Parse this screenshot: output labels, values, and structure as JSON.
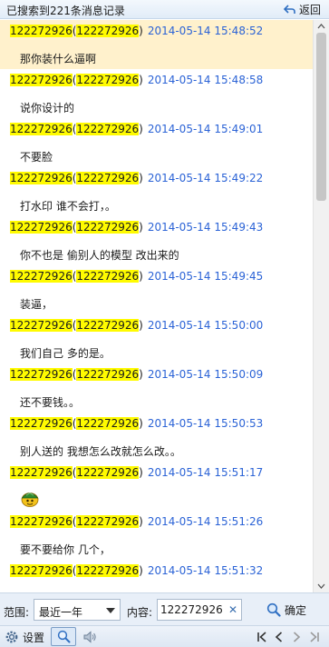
{
  "topbar": {
    "result_text": "已搜索到221条消息记录",
    "back_label": "返回"
  },
  "messages": [
    {
      "sender": "122272926",
      "sender_id": "122272926",
      "timestamp": "2014-05-14 15:48:52",
      "text": "那你装什么逼啊",
      "highlighted": true
    },
    {
      "sender": "122272926",
      "sender_id": "122272926",
      "timestamp": "2014-05-14 15:48:58",
      "text": "说你设计的"
    },
    {
      "sender": "122272926",
      "sender_id": "122272926",
      "timestamp": "2014-05-14 15:49:01",
      "text": "不要脸"
    },
    {
      "sender": "122272926",
      "sender_id": "122272926",
      "timestamp": "2014-05-14 15:49:22",
      "text": "打水印  谁不会打，。"
    },
    {
      "sender": "122272926",
      "sender_id": "122272926",
      "timestamp": "2014-05-14 15:49:43",
      "text": "你不也是  偷别人的模型   改出来的"
    },
    {
      "sender": "122272926",
      "sender_id": "122272926",
      "timestamp": "2014-05-14 15:49:45",
      "text": "装逼，"
    },
    {
      "sender": "122272926",
      "sender_id": "122272926",
      "timestamp": "2014-05-14 15:50:00",
      "text": "我们自己   多的是。"
    },
    {
      "sender": "122272926",
      "sender_id": "122272926",
      "timestamp": "2014-05-14 15:50:09",
      "text": "还不要钱。。"
    },
    {
      "sender": "122272926",
      "sender_id": "122272926",
      "timestamp": "2014-05-14 15:50:53",
      "text": "别人送的   我想怎么改就怎么改。。"
    },
    {
      "sender": "122272926",
      "sender_id": "122272926",
      "timestamp": "2014-05-14 15:51:17",
      "text": "",
      "emoji": "turtle-emoji"
    },
    {
      "sender": "122272926",
      "sender_id": "122272926",
      "timestamp": "2014-05-14 15:51:26",
      "text": "要不要给你  几个，"
    },
    {
      "sender": "122272926",
      "sender_id": "122272926",
      "timestamp": "2014-05-14 15:51:32",
      "text": ""
    }
  ],
  "filter": {
    "range_label": "范围:",
    "range_value": "最近一年",
    "content_label": "内容:",
    "content_value": "122272926",
    "confirm_label": "确定"
  },
  "bottombar": {
    "settings_label": "设置"
  },
  "colors": {
    "highlight": "#fffb00",
    "timestamp": "#2b63d6",
    "selected_row": "#fff1cc"
  }
}
